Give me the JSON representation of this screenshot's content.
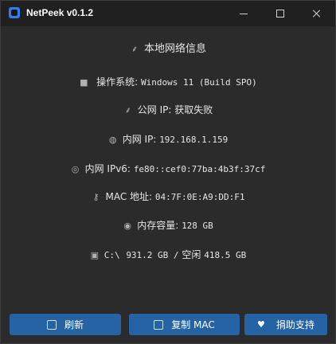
{
  "window": {
    "title": "NetPeek v0.1.2"
  },
  "info": {
    "heading": "本地网络信息",
    "os_label": "操作系统:",
    "os_value": "Windows 11 (Build SPO)",
    "public_ip_label": "公网 IP:",
    "public_ip_value": "获取失败",
    "lan_ip_label": "内网 IP:",
    "lan_ip_value": "192.168.1.159",
    "ipv6_label": "内网 IPv6:",
    "ipv6_value": "fe80::cef0:77ba:4b3f:37cf",
    "mac_label": "MAC 地址:",
    "mac_value": "04:7F:0E:A9:DD:F1",
    "memory_label": "内存容量:",
    "memory_value": "128 GB",
    "disk_drive": "C:\\",
    "disk_total": "931.2 GB /",
    "disk_free_label": "空闲",
    "disk_free_value": "418.5 GB"
  },
  "buttons": {
    "refresh": "刷新",
    "copy_mac": "复制 MAC",
    "donate": "捐助支持"
  },
  "icons": {
    "app": "app-window-icon",
    "network": "network-icon",
    "os": "computer-icon",
    "globe": "globe-icon",
    "ipv6": "disc-icon",
    "mac": "key-icon",
    "memory": "memory-icon",
    "disk": "disk-icon"
  },
  "colors": {
    "background": "#2b2b2b",
    "titlebar": "#202020",
    "button": "#2563a4",
    "text": "#e6e6e6",
    "app_icon": "#2f80ed"
  }
}
